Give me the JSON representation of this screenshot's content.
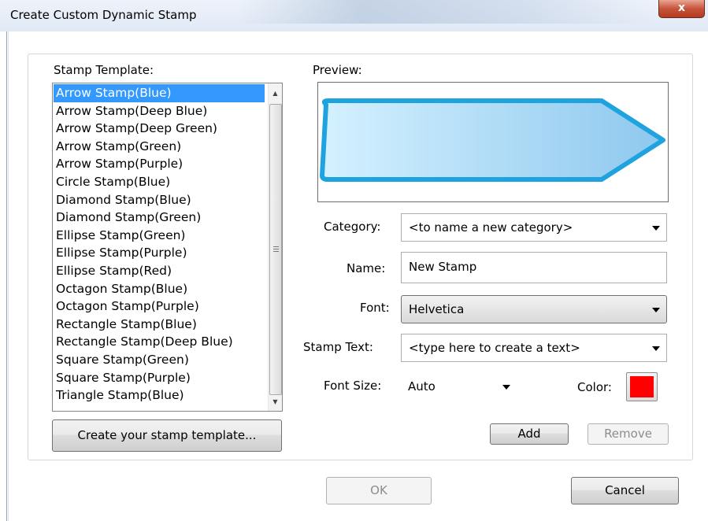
{
  "window": {
    "title": "Create Custom Dynamic Stamp",
    "close_glyph": "x"
  },
  "stamp_template": {
    "label": "Stamp Template:",
    "items": [
      "Arrow Stamp(Blue)",
      "Arrow Stamp(Deep Blue)",
      "Arrow Stamp(Deep Green)",
      "Arrow Stamp(Green)",
      "Arrow Stamp(Purple)",
      "Circle Stamp(Blue)",
      "Diamond Stamp(Blue)",
      "Diamond Stamp(Green)",
      "Ellipse Stamp(Green)",
      "Ellipse Stamp(Purple)",
      "Ellipse Stamp(Red)",
      "Octagon Stamp(Blue)",
      "Octagon Stamp(Purple)",
      "Rectangle Stamp(Blue)",
      "Rectangle Stamp(Deep Blue)",
      "Square Stamp(Green)",
      "Square Stamp(Purple)",
      "Triangle Stamp(Blue)"
    ],
    "selected": "Arrow Stamp(Blue)",
    "create_button": "Create your stamp template..."
  },
  "preview": {
    "label": "Preview:",
    "stroke_color": "#1fa3de",
    "fill_start": "#d4f1ff",
    "fill_end": "#8ec8ee"
  },
  "form": {
    "category": {
      "label": "Category:",
      "value": "<to name a new category>"
    },
    "name": {
      "label": "Name:",
      "value": "New Stamp"
    },
    "font": {
      "label": "Font:",
      "value": "Helvetica"
    },
    "stamp_text": {
      "label": "Stamp Text:",
      "value": "<type here to create a text>"
    },
    "font_size": {
      "label": "Font Size:",
      "value": "Auto"
    },
    "color": {
      "label": "Color:",
      "value": "#ff0000"
    }
  },
  "buttons": {
    "add": "Add",
    "remove": "Remove",
    "ok": "OK",
    "cancel": "Cancel"
  }
}
